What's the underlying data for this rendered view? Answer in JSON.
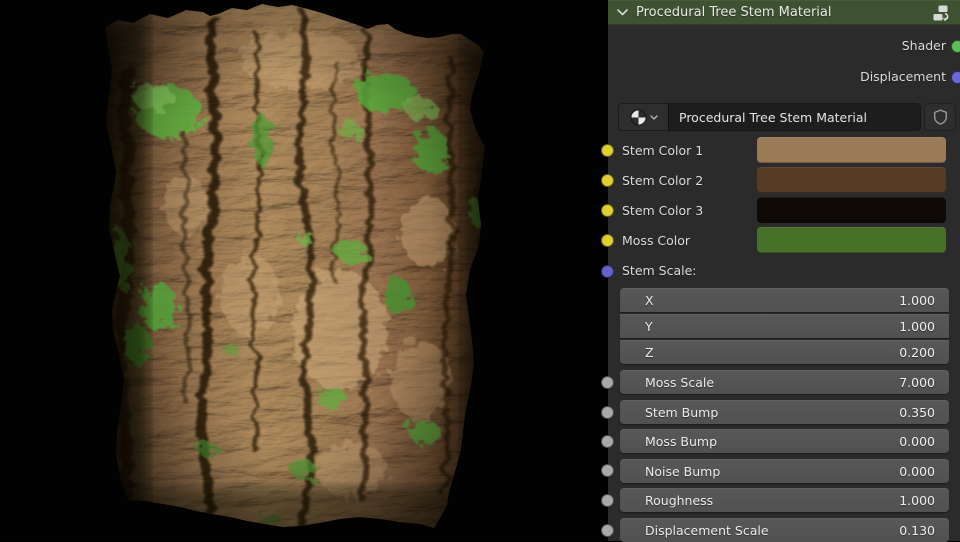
{
  "viewport": {
    "background": "#000000",
    "render": "tree-bark-block-render"
  },
  "panel": {
    "header": {
      "title": "Procedural Tree Stem Material",
      "collapse_icon": "chevron-down-icon",
      "group_icon": "node-group-icon"
    },
    "outputs": [
      {
        "label": "Shader",
        "socket_color": "#5bbf57"
      },
      {
        "label": "Displacement",
        "socket_color": "#6c68d8"
      }
    ],
    "material": {
      "name": "Procedural Tree Stem Material",
      "browse_icon": "material-sphere-icon",
      "fake_user_icon": "shield-icon"
    },
    "colors": [
      {
        "label": "Stem Color 1",
        "value": "#9b7a58",
        "socket_color": "#e0cf30"
      },
      {
        "label": "Stem Color 2",
        "value": "#553a24",
        "socket_color": "#e0cf30"
      },
      {
        "label": "Stem Color 3",
        "value": "#0f0a06",
        "socket_color": "#e0cf30"
      },
      {
        "label": "Moss Color",
        "value": "#477029",
        "socket_color": "#e0cf30"
      }
    ],
    "vector_group": {
      "label": "Stem Scale:",
      "socket_color": "#6562c9",
      "components": [
        {
          "label": "X",
          "value": "1.000"
        },
        {
          "label": "Y",
          "value": "1.000"
        },
        {
          "label": "Z",
          "value": "0.200"
        }
      ]
    },
    "sliders": [
      {
        "label": "Moss Scale",
        "value": "7.000",
        "socket_color": "#a8a8a8"
      },
      {
        "label": "Stem Bump",
        "value": "0.350",
        "socket_color": "#a8a8a8"
      },
      {
        "label": "Moss Bump",
        "value": "0.000",
        "socket_color": "#a8a8a8"
      },
      {
        "label": "Noise Bump",
        "value": "0.000",
        "socket_color": "#a8a8a8"
      },
      {
        "label": "Roughness",
        "value": "1.000",
        "socket_color": "#a8a8a8"
      },
      {
        "label": "Displacement Scale",
        "value": "0.130",
        "socket_color": "#a8a8a8"
      }
    ]
  }
}
